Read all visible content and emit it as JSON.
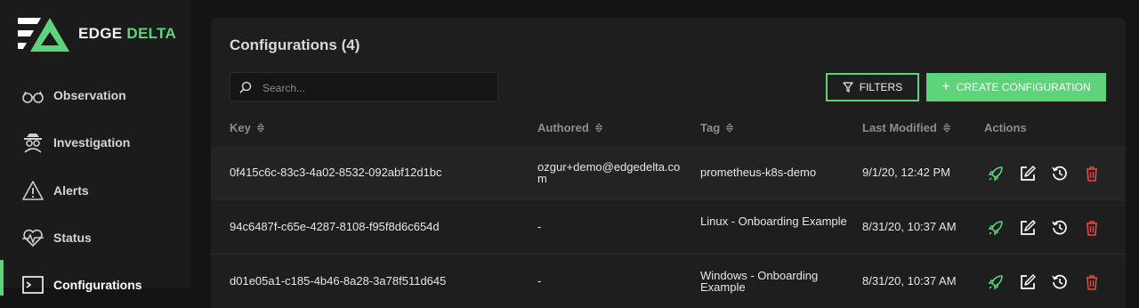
{
  "brand": {
    "name_part1": "EDGE",
    "name_part2": "DELTA"
  },
  "sidebar": {
    "items": [
      {
        "label": "Observation",
        "icon": "glasses-icon"
      },
      {
        "label": "Investigation",
        "icon": "spy-icon"
      },
      {
        "label": "Alerts",
        "icon": "warning-icon"
      },
      {
        "label": "Status",
        "icon": "heartbeat-icon"
      },
      {
        "label": "Configurations",
        "icon": "terminal-icon",
        "active": true
      }
    ]
  },
  "page": {
    "title": "Configurations (4)"
  },
  "search": {
    "placeholder": "Search..."
  },
  "toolbar": {
    "filters_label": "FILTERS",
    "create_label": "CREATE CONFIGURATION"
  },
  "table": {
    "columns": [
      "Key",
      "Authored",
      "Tag",
      "Last Modified",
      "Actions"
    ],
    "rows": [
      {
        "key": "0f415c6c-83c3-4a02-8532-092abf12d1bc",
        "authored": "ozgur+demo@edgedelta.com",
        "tag": "prometheus-k8s-demo",
        "modified": "9/1/20, 12:42 PM"
      },
      {
        "key": "94c6487f-c65e-4287-8108-f95f8d6c654d",
        "authored": "-",
        "tag": "Linux - Onboarding Example",
        "modified": "8/31/20, 10:37 AM"
      },
      {
        "key": "d01e05a1-c185-4b46-8a28-3a78f511d645",
        "authored": "-",
        "tag": "Windows - Onboarding Example",
        "modified": "8/31/20, 10:37 AM"
      }
    ]
  },
  "colors": {
    "accent": "#5fd37a",
    "danger": "#e04a3f"
  }
}
